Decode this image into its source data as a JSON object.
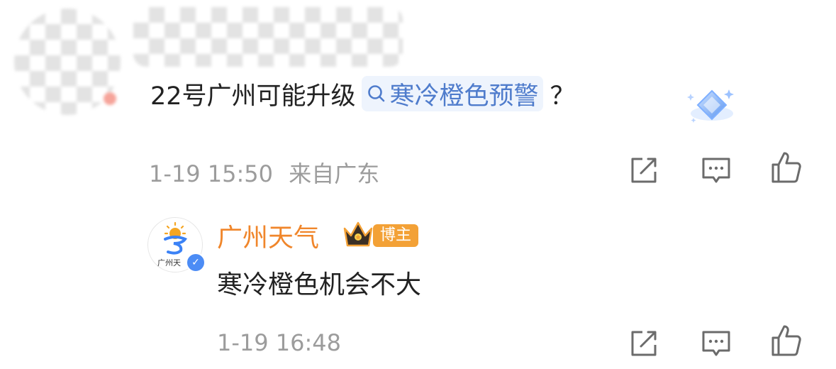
{
  "comment": {
    "text_prefix": "22号广州可能升级",
    "topic": "寒冷橙色预警",
    "text_suffix": "？",
    "time": "1-19 15:50",
    "location": "来自广东"
  },
  "reply": {
    "author": "广州天气",
    "author_badge": "博主",
    "avatar_caption": "广州天",
    "text": "寒冷橙色机会不大",
    "time": "1-19 16:48"
  },
  "icons": {
    "share": "share-icon",
    "comment": "comment-icon",
    "like": "thumbs-up-icon",
    "search": "search-icon",
    "gem": "diamond-badge-icon",
    "crown": "crown-icon",
    "verified": "verified-icon"
  },
  "colors": {
    "topic_link": "#4f7ccc",
    "author_name": "#f0862b",
    "badge": "#f3a136",
    "meta": "#9c9c9c"
  }
}
